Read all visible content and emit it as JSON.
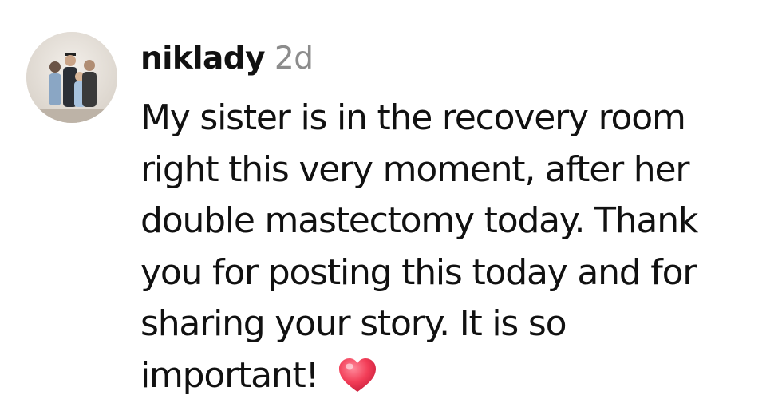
{
  "comment": {
    "username": "niklady",
    "time_ago": "2d",
    "text_lines": [
      "My sister is in the recovery room",
      "right this very moment, after her",
      "double mastectomy today. Thank",
      "you for posting this today and for",
      "sharing your story. It is so",
      "important! "
    ],
    "emoji": "heart-emoji",
    "emoji_color": "#f23d57"
  }
}
